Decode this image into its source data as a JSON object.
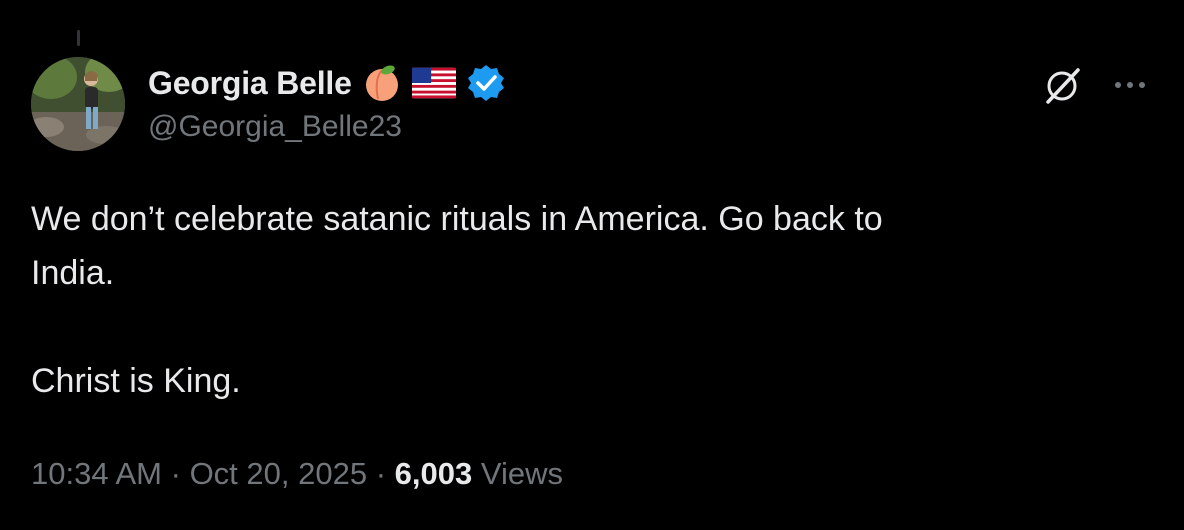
{
  "author": {
    "display_name": "Georgia Belle",
    "handle": "@Georgia_Belle23",
    "badges": [
      "peach-emoji",
      "us-flag-emoji",
      "verified-badge"
    ],
    "verified_color": "#1d9bf0"
  },
  "tweet": {
    "text": "We don’t celebrate satanic rituals in America. Go back to\nIndia.\n\nChrist is King."
  },
  "meta": {
    "time": "10:34 AM",
    "separator": "·",
    "date": "Oct 20, 2025",
    "views_count": "6,003",
    "views_label": "Views"
  },
  "actions": {
    "grok_icon": "grok-icon",
    "more_icon": "more-options-icon"
  },
  "colors": {
    "background": "#000000",
    "primary_text": "#e7e9ea",
    "secondary_text": "#71767b"
  }
}
